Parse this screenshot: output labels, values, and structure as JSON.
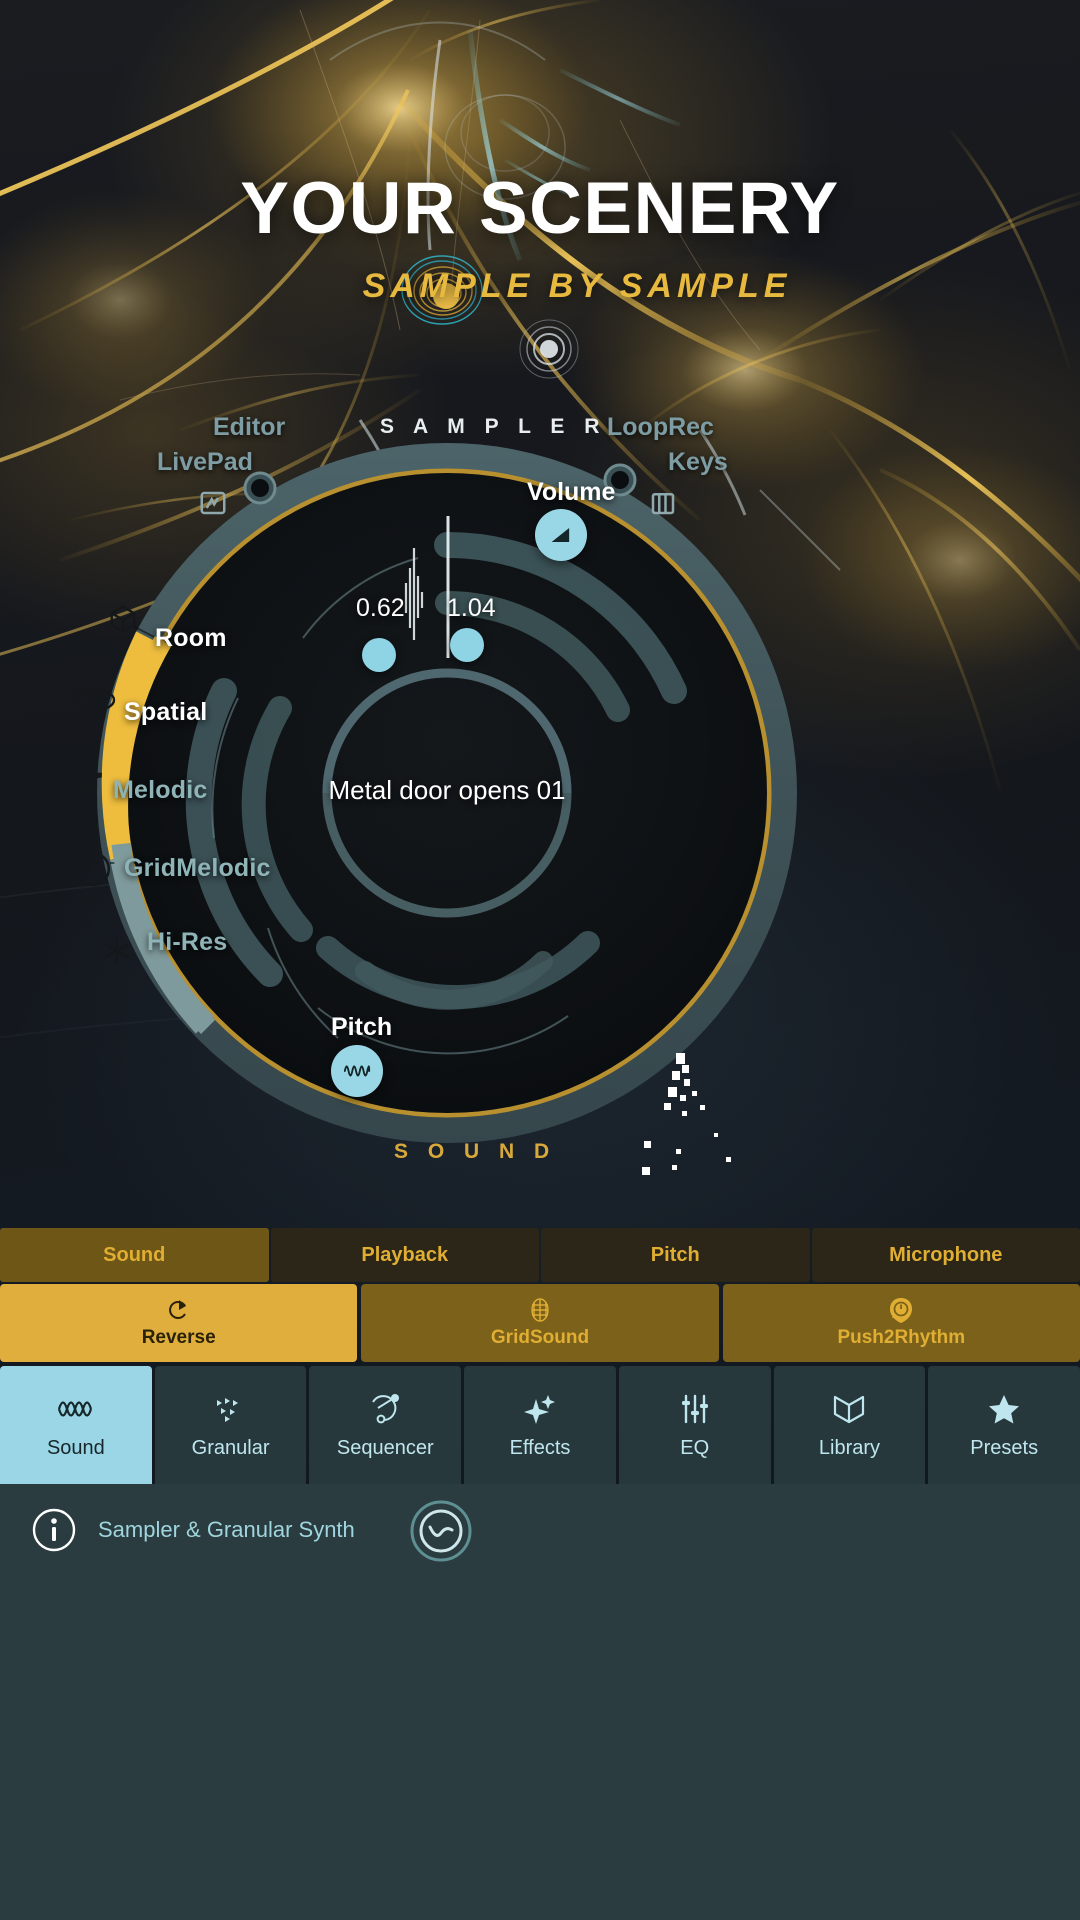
{
  "app": {
    "title": "YOUR SCENERY",
    "subtitle": "SAMPLE BY SAMPLE"
  },
  "dial": {
    "cap_top": "S A M P L E R",
    "cap_bottom": "S O U N D",
    "center_sample_name": "Metal door opens 01",
    "outer_links": [
      {
        "name": "editor",
        "label": "Editor"
      },
      {
        "name": "livepad",
        "label": "LivePad"
      },
      {
        "name": "looprec",
        "label": "LoopRec"
      },
      {
        "name": "keys",
        "label": "Keys"
      }
    ],
    "categories": [
      {
        "label": "Room",
        "icon": "cube-icon",
        "state": "active"
      },
      {
        "label": "Spatial",
        "icon": "spatial-icon",
        "state": "active"
      },
      {
        "label": "Melodic",
        "icon": "note-icon",
        "state": "inactive"
      },
      {
        "label": "GridMelodic",
        "icon": "circled-note-icon",
        "state": "inactive"
      },
      {
        "label": "Hi-Res",
        "icon": "asterisk-icon",
        "state": "inactive"
      }
    ],
    "knobs": [
      {
        "label": "Volume",
        "icon": "volume-icon"
      },
      {
        "label": "Pitch",
        "icon": "waveform-icon"
      }
    ],
    "handles": [
      {
        "value": "0.62"
      },
      {
        "value": "1.04"
      }
    ]
  },
  "tabs_primary": [
    {
      "label": "Sound",
      "active": true
    },
    {
      "label": "Playback",
      "active": false
    },
    {
      "label": "Pitch",
      "active": false
    },
    {
      "label": "Microphone",
      "active": false
    }
  ],
  "tabs_secondary": [
    {
      "label": "Reverse",
      "icon": "reverse-icon",
      "active": true
    },
    {
      "label": "GridSound",
      "icon": "grid-icon",
      "active": false
    },
    {
      "label": "Push2Rhythm",
      "icon": "push2rhythm-icon",
      "active": false
    }
  ],
  "nav": [
    {
      "label": "Sound",
      "icon": "waveform-icon",
      "active": true
    },
    {
      "label": "Granular",
      "icon": "granular-icon",
      "active": false
    },
    {
      "label": "Sequencer",
      "icon": "sequencer-icon",
      "active": false
    },
    {
      "label": "Effects",
      "icon": "sparkle-icon",
      "active": false
    },
    {
      "label": "EQ",
      "icon": "sliders-icon",
      "active": false
    },
    {
      "label": "Library",
      "icon": "book-icon",
      "active": false
    },
    {
      "label": "Presets",
      "icon": "star-icon",
      "active": false
    }
  ],
  "footer": {
    "info_label": "Sampler & Granular Synth",
    "info_icon": "info-icon",
    "logo_icon": "brand-logo-icon"
  },
  "colors": {
    "gold": "#e0ae33",
    "gold_bright": "#dfae3c",
    "cyan": "#9ad6e5",
    "panel": "#26383c",
    "footer_bg": "#2b3c40"
  }
}
